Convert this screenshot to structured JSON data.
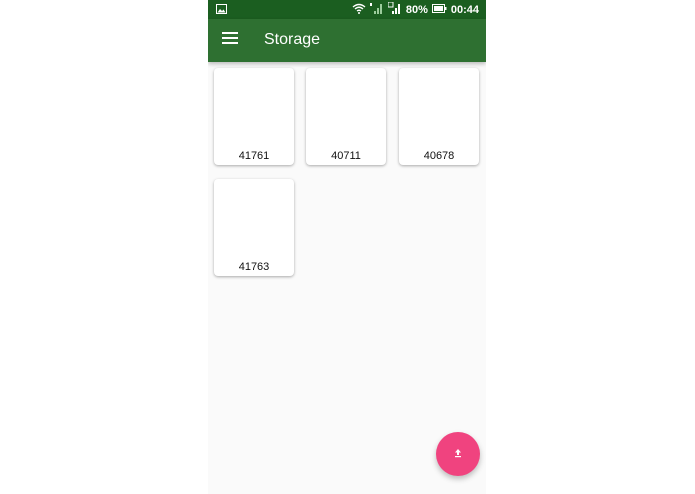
{
  "status_bar": {
    "battery_percent": "80%",
    "time": "00:44",
    "icons": [
      "image-notification-icon",
      "wifi-icon",
      "signal-icon",
      "signal-icon",
      "battery-icon"
    ]
  },
  "app_bar": {
    "title": "Storage",
    "menu_icon": "menu-icon"
  },
  "items": [
    {
      "label": "41761"
    },
    {
      "label": "40711"
    },
    {
      "label": "40678"
    },
    {
      "label": "41763"
    }
  ],
  "fab": {
    "icon": "upload-icon",
    "color": "#f0437f"
  },
  "colors": {
    "status_bar": "#1b5e20",
    "app_bar": "#2e7031",
    "background": "#fafafa"
  }
}
